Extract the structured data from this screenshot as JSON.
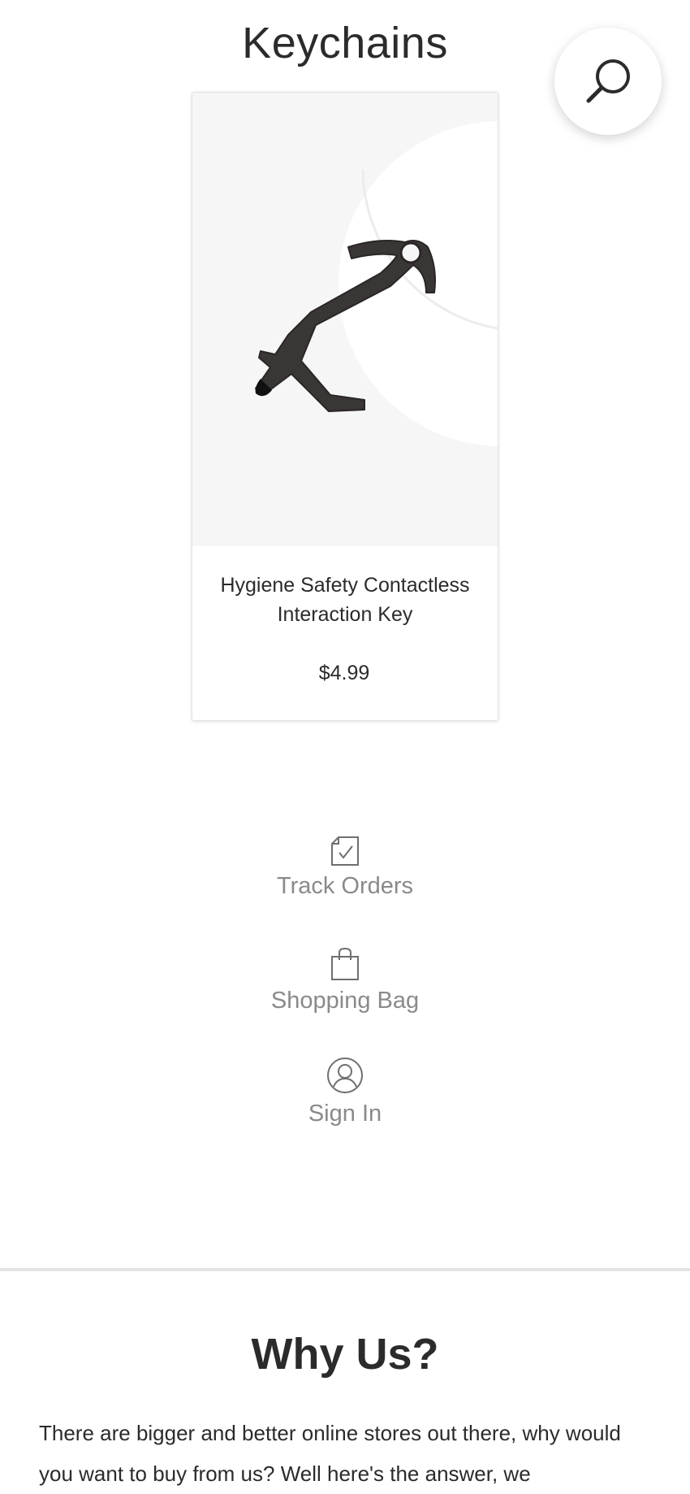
{
  "header": {
    "title": "Keychains",
    "search_icon": "search-icon"
  },
  "product": {
    "name": "Hygiene Safety Contactless Interaction Key",
    "price": "$4.99",
    "image_icon": "keychain-tool-image"
  },
  "utility": {
    "items": [
      {
        "label": "Track Orders",
        "icon": "track-orders-icon"
      },
      {
        "label": "Shopping Bag",
        "icon": "shopping-bag-icon"
      },
      {
        "label": "Sign In",
        "icon": "user-icon"
      }
    ]
  },
  "why_us": {
    "title": "Why Us?",
    "body": "There are bigger and better online stores out there, why would you want to buy from us? Well here's the answer, we"
  },
  "colors": {
    "text": "#2b2b2b",
    "muted": "#8a8a8a",
    "divider": "#e3e3e3"
  }
}
